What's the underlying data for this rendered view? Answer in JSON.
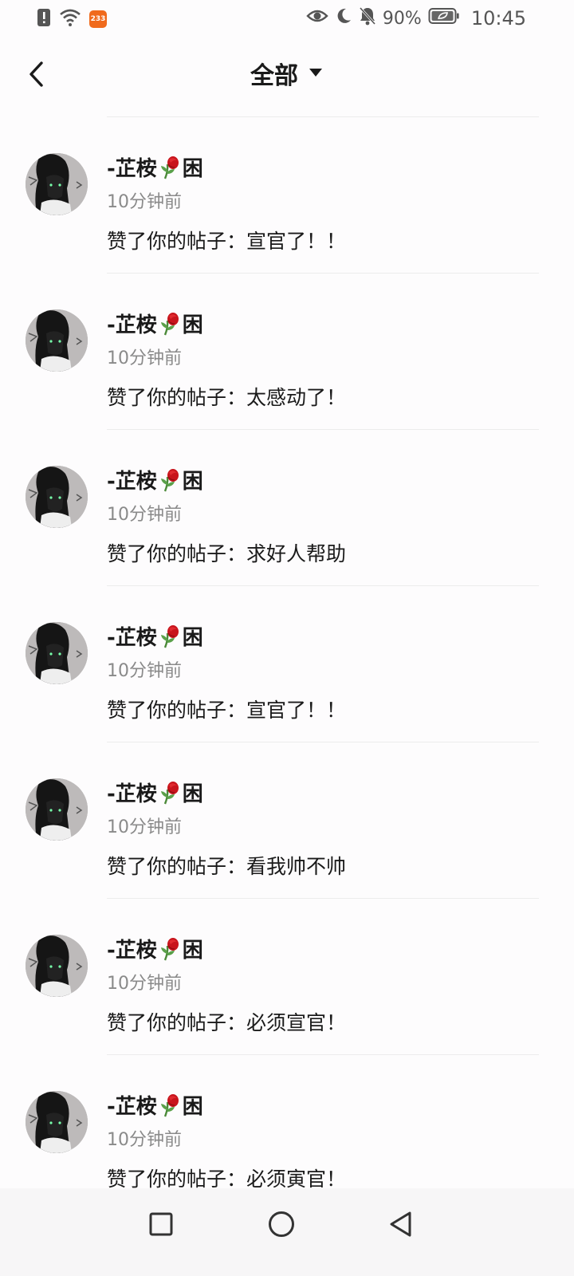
{
  "status_bar": {
    "left_icons": [
      "alert-icon",
      "wifi-icon",
      "app-badge-icon"
    ],
    "app_badge_text": "233",
    "right_icons": [
      "eye-icon",
      "moon-icon",
      "bell-off-icon",
      "battery-icon"
    ],
    "battery_percent": "90%",
    "time": "10:45"
  },
  "header": {
    "back_icon": "chevron-left-icon",
    "title": "全部",
    "dropdown_icon": "caret-down-icon"
  },
  "notifications": [
    {
      "name_prefix": "-芷桉",
      "name_suffix": "困",
      "time": "10分钟前",
      "text": "赞了你的帖子：宣官了！！"
    },
    {
      "name_prefix": "-芷桉",
      "name_suffix": "困",
      "time": "10分钟前",
      "text": "赞了你的帖子：太感动了！"
    },
    {
      "name_prefix": "-芷桉",
      "name_suffix": "困",
      "time": "10分钟前",
      "text": "赞了你的帖子：求好人帮助"
    },
    {
      "name_prefix": "-芷桉",
      "name_suffix": "困",
      "time": "10分钟前",
      "text": "赞了你的帖子：宣官了！！"
    },
    {
      "name_prefix": "-芷桉",
      "name_suffix": "困",
      "time": "10分钟前",
      "text": "赞了你的帖子：看我帅不帅"
    },
    {
      "name_prefix": "-芷桉",
      "name_suffix": "困",
      "time": "10分钟前",
      "text": "赞了你的帖子：必须宣官！"
    },
    {
      "name_prefix": "-芷桉",
      "name_suffix": "困",
      "time": "10分钟前",
      "text": "赞了你的帖子：必须寅官！"
    }
  ],
  "nav_bar": {
    "icons": [
      "recents-square-icon",
      "home-circle-icon",
      "back-triangle-icon"
    ]
  },
  "colors": {
    "background": "#fdfcfd",
    "text_primary": "#1a1a1a",
    "text_secondary": "#8a8a8a",
    "divider": "#ececec",
    "app_badge": "#f06a1c"
  }
}
